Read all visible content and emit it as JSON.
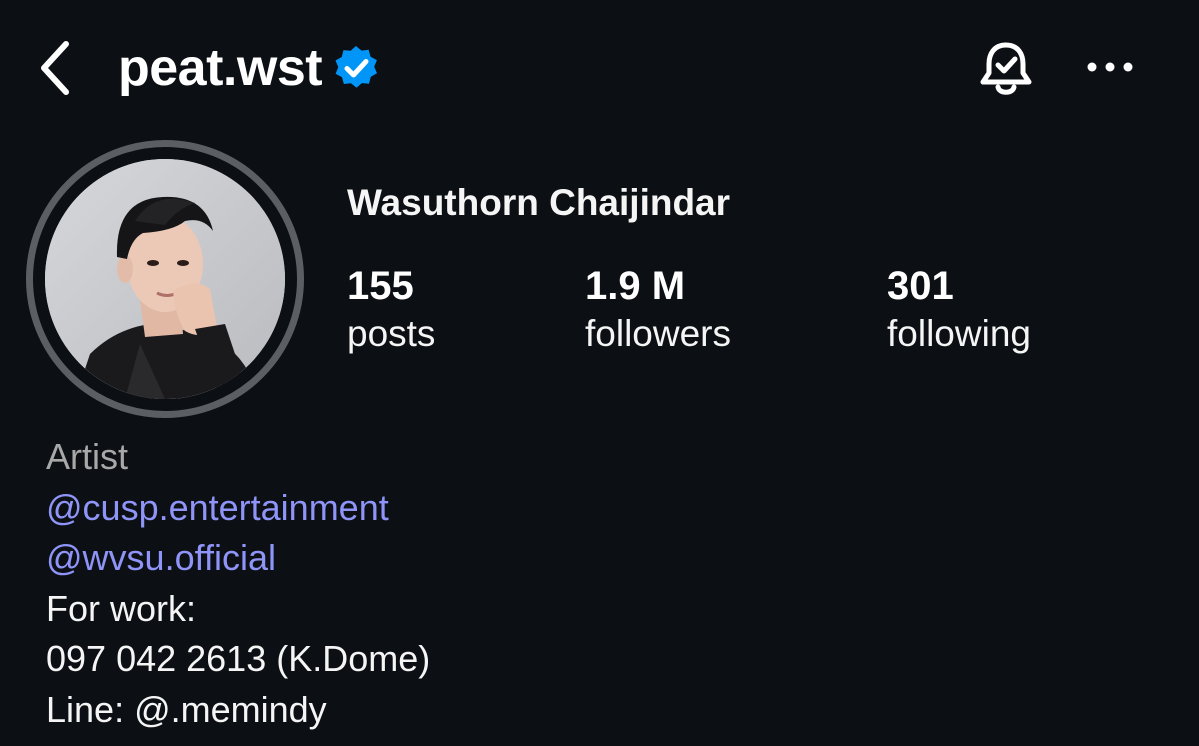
{
  "header": {
    "username": "peat.wst",
    "icons": {
      "back": "chevron-left-icon",
      "verified": "verified-badge-icon",
      "notifications": "bell-check-icon",
      "more": "more-horizontal-icon"
    }
  },
  "profile": {
    "full_name": "Wasuthorn Chaijindar",
    "stats": [
      {
        "value": "155",
        "label": "posts"
      },
      {
        "value": "1.9 M",
        "label": "followers"
      },
      {
        "value": "301",
        "label": "following"
      }
    ]
  },
  "bio": {
    "category": "Artist",
    "mentions": [
      "@cusp.entertainment",
      "@wvsu.official"
    ],
    "lines": [
      "For work:",
      "097 042 2613 (K.Dome)",
      "Line: @.memindy"
    ]
  },
  "colors": {
    "background": "#0c1014",
    "verified": "#0095f6",
    "mention": "#8f94f8",
    "muted": "#a8a8a8"
  }
}
